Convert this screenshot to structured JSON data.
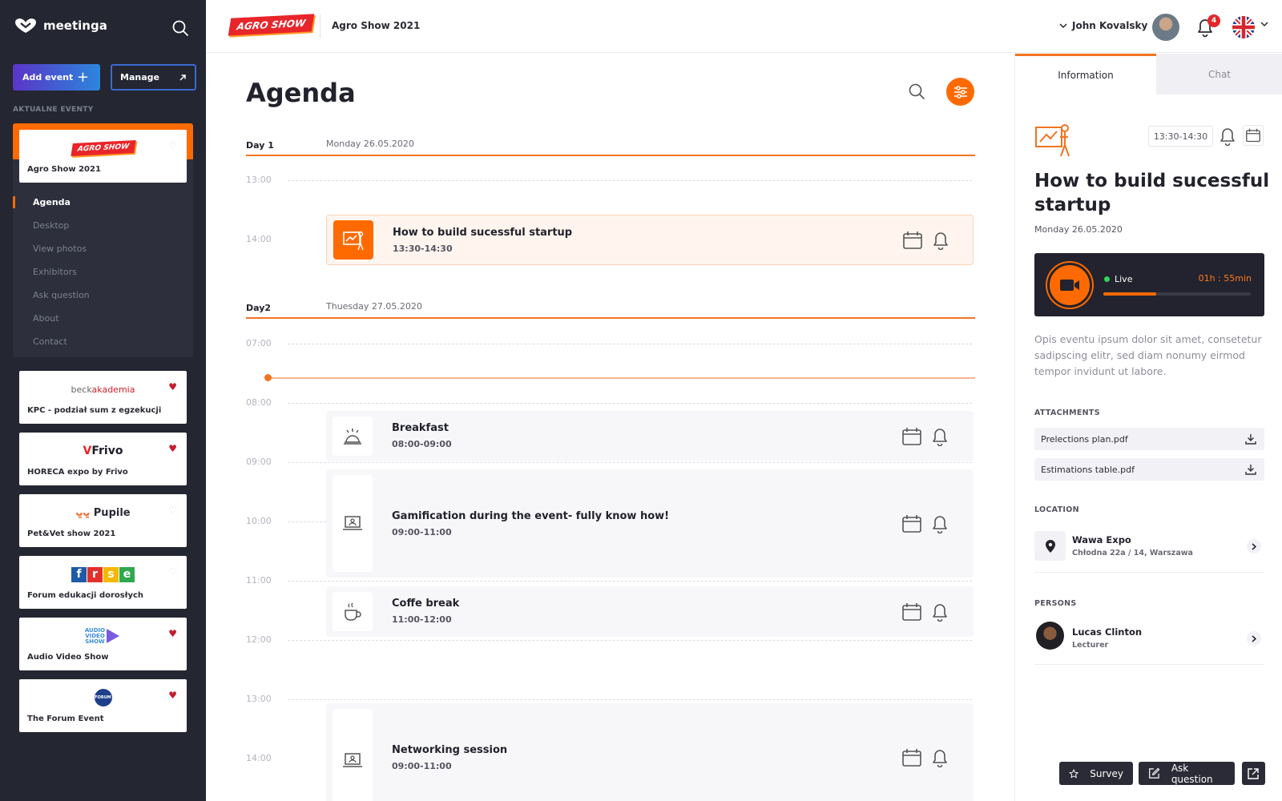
{
  "app": {
    "brand": "meetinga",
    "current_event_logo": "AGRO SHOW",
    "current_event_title": "Agro Show 2021"
  },
  "colors": {
    "accent": "#ff6a00",
    "sidebar_bg": "#242632",
    "live_green": "#35d35a",
    "favorite_red": "#c21f2b"
  },
  "sidebar": {
    "add_event_label": "Add event",
    "manage_label": "Manage",
    "section_label": "AKTUALNE EVENTY",
    "active_event": {
      "logo": "AGRO SHOW",
      "name": "Agro Show 2021",
      "favorite": false
    },
    "nav": [
      {
        "label": "Agenda",
        "active": true
      },
      {
        "label": "Desktop",
        "active": false
      },
      {
        "label": "View photos",
        "active": false
      },
      {
        "label": "Exhibitors",
        "active": false
      },
      {
        "label": "Ask question",
        "active": false
      },
      {
        "label": "About",
        "active": false
      },
      {
        "label": "Contact",
        "active": false
      }
    ],
    "events": [
      {
        "logo_a": "beck",
        "logo_b": "akademia",
        "name": "KPC - podział sum z egzekucji",
        "favorite": true
      },
      {
        "logo_a": "V",
        "logo_b": "Frivo",
        "name": "HORECA expo by Frivo",
        "favorite": true
      },
      {
        "logo_a": "ᴗ͈ᴗ͈",
        "logo_b": "Pupile",
        "name": "Pet&Vet show 2021",
        "favorite": false
      },
      {
        "logo_a": "frse",
        "logo_b": "",
        "name": "Forum edukacji dorosłych",
        "favorite": false
      },
      {
        "logo_a": "AUDIO VIDEO SHOW",
        "logo_b": "",
        "name": "Audio Video Show",
        "favorite": true
      },
      {
        "logo_a": "FORUM",
        "logo_b": "",
        "name": "The Forum Event",
        "favorite": true
      }
    ]
  },
  "topbar": {
    "user_name": "John Kovalsky",
    "notifications_count": "4",
    "language_icon": "uk-flag-icon"
  },
  "agenda": {
    "title": "Agenda",
    "days": [
      {
        "label": "Day 1",
        "date": "Monday 26.05.2020",
        "hours": [
          "13:00",
          "14:00"
        ]
      },
      {
        "label": "Day2",
        "date": "Thuesday 27.05.2020",
        "hours": [
          "07:00",
          "08:00",
          "09:00",
          "10:00",
          "11:00",
          "12:00",
          "13:00",
          "14:00"
        ]
      }
    ],
    "sessions": [
      {
        "title": "How to build sucessful startup",
        "time": "13:30-14:30",
        "icon": "presentation-icon",
        "highlighted": true
      },
      {
        "title": "Breakfast",
        "time": "08:00-09:00",
        "icon": "food-cloche-icon",
        "highlighted": false
      },
      {
        "title": "Gamification during the event- fully know how!",
        "time": "09:00-11:00",
        "icon": "laptop-user-icon",
        "highlighted": false
      },
      {
        "title": "Coffe break",
        "time": "11:00-12:00",
        "icon": "coffee-cup-icon",
        "highlighted": false
      },
      {
        "title": "Networking session",
        "time": "09:00-11:00",
        "icon": "laptop-user-icon",
        "highlighted": false
      }
    ]
  },
  "panel": {
    "tabs": [
      {
        "label": "Information",
        "active": true
      },
      {
        "label": "Chat",
        "active": false
      }
    ],
    "time_chip": "13:30-14:30",
    "title": "How to build sucessful startup",
    "date": "Monday 26.05.2020",
    "live": {
      "status": "Live",
      "timer": "01h : 55min",
      "progress": 0.36
    },
    "description": "Opis eventu ipsum dolor sit amet, consetetur sadipscing elitr, sed diam nonumy eirmod tempor invidunt ut labore.",
    "attachments_label": "ATTACHMENTS",
    "attachments": [
      "Prelections plan.pdf",
      "Estimations table.pdf"
    ],
    "location_label": "LOCATION",
    "location": {
      "name": "Wawa Expo",
      "address": "Chłodna 22a / 14, Warszawa"
    },
    "persons_label": "PERSONS",
    "persons": [
      {
        "name": "Lucas Clinton",
        "role": "Lecturer"
      }
    ],
    "actions": {
      "survey": "Survey",
      "ask_question": "Ask question"
    }
  }
}
